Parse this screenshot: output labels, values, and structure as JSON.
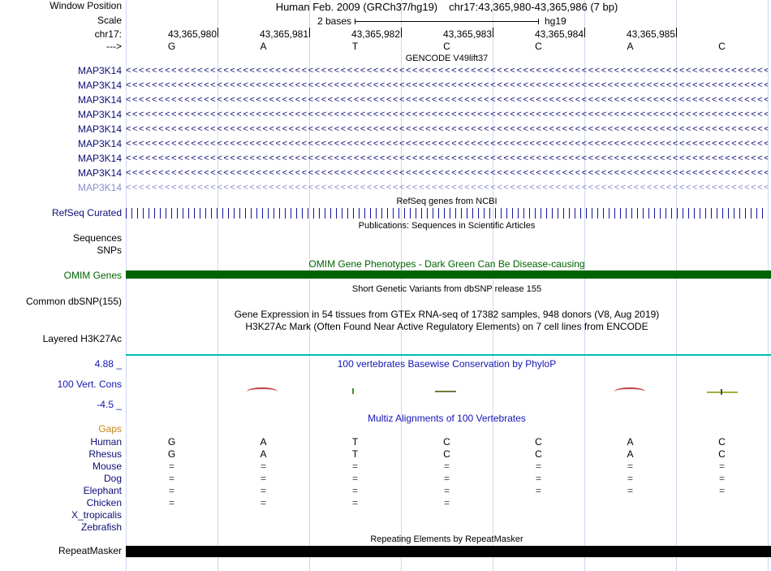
{
  "header": {
    "window_position_label": "Window Position",
    "assembly_title": "Human Feb. 2009 (GRCh37/hg19)",
    "position_range": "chr17:43,365,980-43,365,986 (7 bp)",
    "scale_label": "Scale",
    "scale_value": "2 bases",
    "assembly_short": "hg19",
    "chrom_label": "chr17:",
    "strand_label": "--->"
  },
  "ruler": {
    "coords": [
      "43,365,980",
      "43,365,981",
      "43,365,982",
      "43,365,983",
      "43,365,984",
      "43,365,985"
    ],
    "bases": [
      "G",
      "A",
      "T",
      "C",
      "C",
      "A",
      "C"
    ]
  },
  "colors": {
    "gene_dark_blue": "#0C0C78",
    "gene_light_blue": "#8A8AD0",
    "omim_green": "#006400",
    "h3k27ac_teal": "#00BCBC",
    "conservation_blue": "#1414B4",
    "gaps_orange": "#C38617",
    "repeat_black": "#000000"
  },
  "tracks": {
    "gencode": {
      "title": "GENCODE V49lift37",
      "genes": [
        {
          "label": "MAP3K14",
          "shade": "dark"
        },
        {
          "label": "MAP3K14",
          "shade": "dark"
        },
        {
          "label": "MAP3K14",
          "shade": "dark"
        },
        {
          "label": "MAP3K14",
          "shade": "dark"
        },
        {
          "label": "MAP3K14",
          "shade": "dark"
        },
        {
          "label": "MAP3K14",
          "shade": "dark"
        },
        {
          "label": "MAP3K14",
          "shade": "dark"
        },
        {
          "label": "MAP3K14",
          "shade": "dark"
        },
        {
          "label": "MAP3K14",
          "shade": "light"
        }
      ]
    },
    "refseq": {
      "title": "RefSeq genes from NCBI",
      "label": "RefSeq Curated"
    },
    "publications": {
      "title": "Publications: Sequences in Scientific Articles",
      "sequences_label": "Sequences",
      "snps_label": "SNPs"
    },
    "omim": {
      "title": "OMIM Gene Phenotypes - Dark Green Can Be Disease-causing",
      "label": "OMIM Genes",
      "bar_color": "#006400"
    },
    "dbsnp": {
      "title": "Short Genetic Variants from dbSNP release 155",
      "label": "Common dbSNP(155)"
    },
    "gtex": {
      "title": "Gene Expression in 54 tissues from GTEx RNA-seq of 17382 samples, 948 donors (V8, Aug 2019)"
    },
    "h3k27ac": {
      "title": "H3K27Ac Mark (Often Found Near Active Regulatory Elements) on 7 cell lines from ENCODE",
      "label": "Layered H3K27Ac",
      "line_color": "#00BCBC"
    },
    "phylop": {
      "title": "100 vertebrates Basewise Conservation by PhyloP",
      "label": "100 Vert. Cons",
      "axis_max": "4.88 _",
      "axis_min": "-4.5 _",
      "marks": [
        {
          "base_index": 1,
          "style": "red-arc"
        },
        {
          "base_index": 2,
          "style": "green-tick"
        },
        {
          "base_index": 3,
          "style": "olive-dash"
        },
        {
          "base_index": 5,
          "style": "red-arc"
        },
        {
          "base_index": 6,
          "style": "yellow-green-dash"
        }
      ]
    },
    "multiz": {
      "title": "Multiz Alignments of 100 Vertebrates",
      "gaps_label": "Gaps",
      "species": [
        {
          "name": "Human",
          "cells": [
            "G",
            "A",
            "T",
            "C",
            "C",
            "A",
            "C"
          ]
        },
        {
          "name": "Rhesus",
          "cells": [
            "G",
            "A",
            "T",
            "C",
            "C",
            "A",
            "C"
          ]
        },
        {
          "name": "Mouse",
          "cells": [
            "=",
            "=",
            "=",
            "=",
            "=",
            "=",
            "="
          ]
        },
        {
          "name": "Dog",
          "cells": [
            "=",
            "=",
            "=",
            "=",
            "=",
            "=",
            "="
          ]
        },
        {
          "name": "Elephant",
          "cells": [
            "=",
            "=",
            "=",
            "=",
            "=",
            "=",
            "="
          ]
        },
        {
          "name": "Chicken",
          "cells": [
            "=",
            "=",
            "=",
            "=",
            "",
            "",
            ""
          ]
        },
        {
          "name": "X_tropicalis",
          "cells": [
            "",
            "",
            "",
            "",
            "",
            "",
            ""
          ]
        },
        {
          "name": "Zebrafish",
          "cells": [
            "",
            "",
            "",
            "",
            "",
            "",
            ""
          ]
        }
      ]
    },
    "repeatmasker": {
      "title": "Repeating Elements by RepeatMasker",
      "label": "RepeatMasker",
      "bar_color": "#000000"
    }
  }
}
